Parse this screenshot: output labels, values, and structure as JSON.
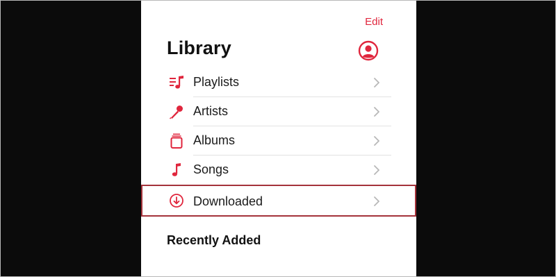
{
  "header": {
    "edit_label": "Edit",
    "title": "Library"
  },
  "library_items": [
    {
      "label": "Playlists",
      "icon": "playlist-icon"
    },
    {
      "label": "Artists",
      "icon": "microphone-icon"
    },
    {
      "label": "Albums",
      "icon": "album-stack-icon"
    },
    {
      "label": "Songs",
      "icon": "music-note-icon"
    },
    {
      "label": "Downloaded",
      "icon": "download-circle-icon",
      "highlighted": true
    }
  ],
  "sections": {
    "recently_added": "Recently Added"
  },
  "colors": {
    "accent": "#e0263d",
    "highlight_border": "#a4323a",
    "letterbox": "#0b0b0b"
  }
}
